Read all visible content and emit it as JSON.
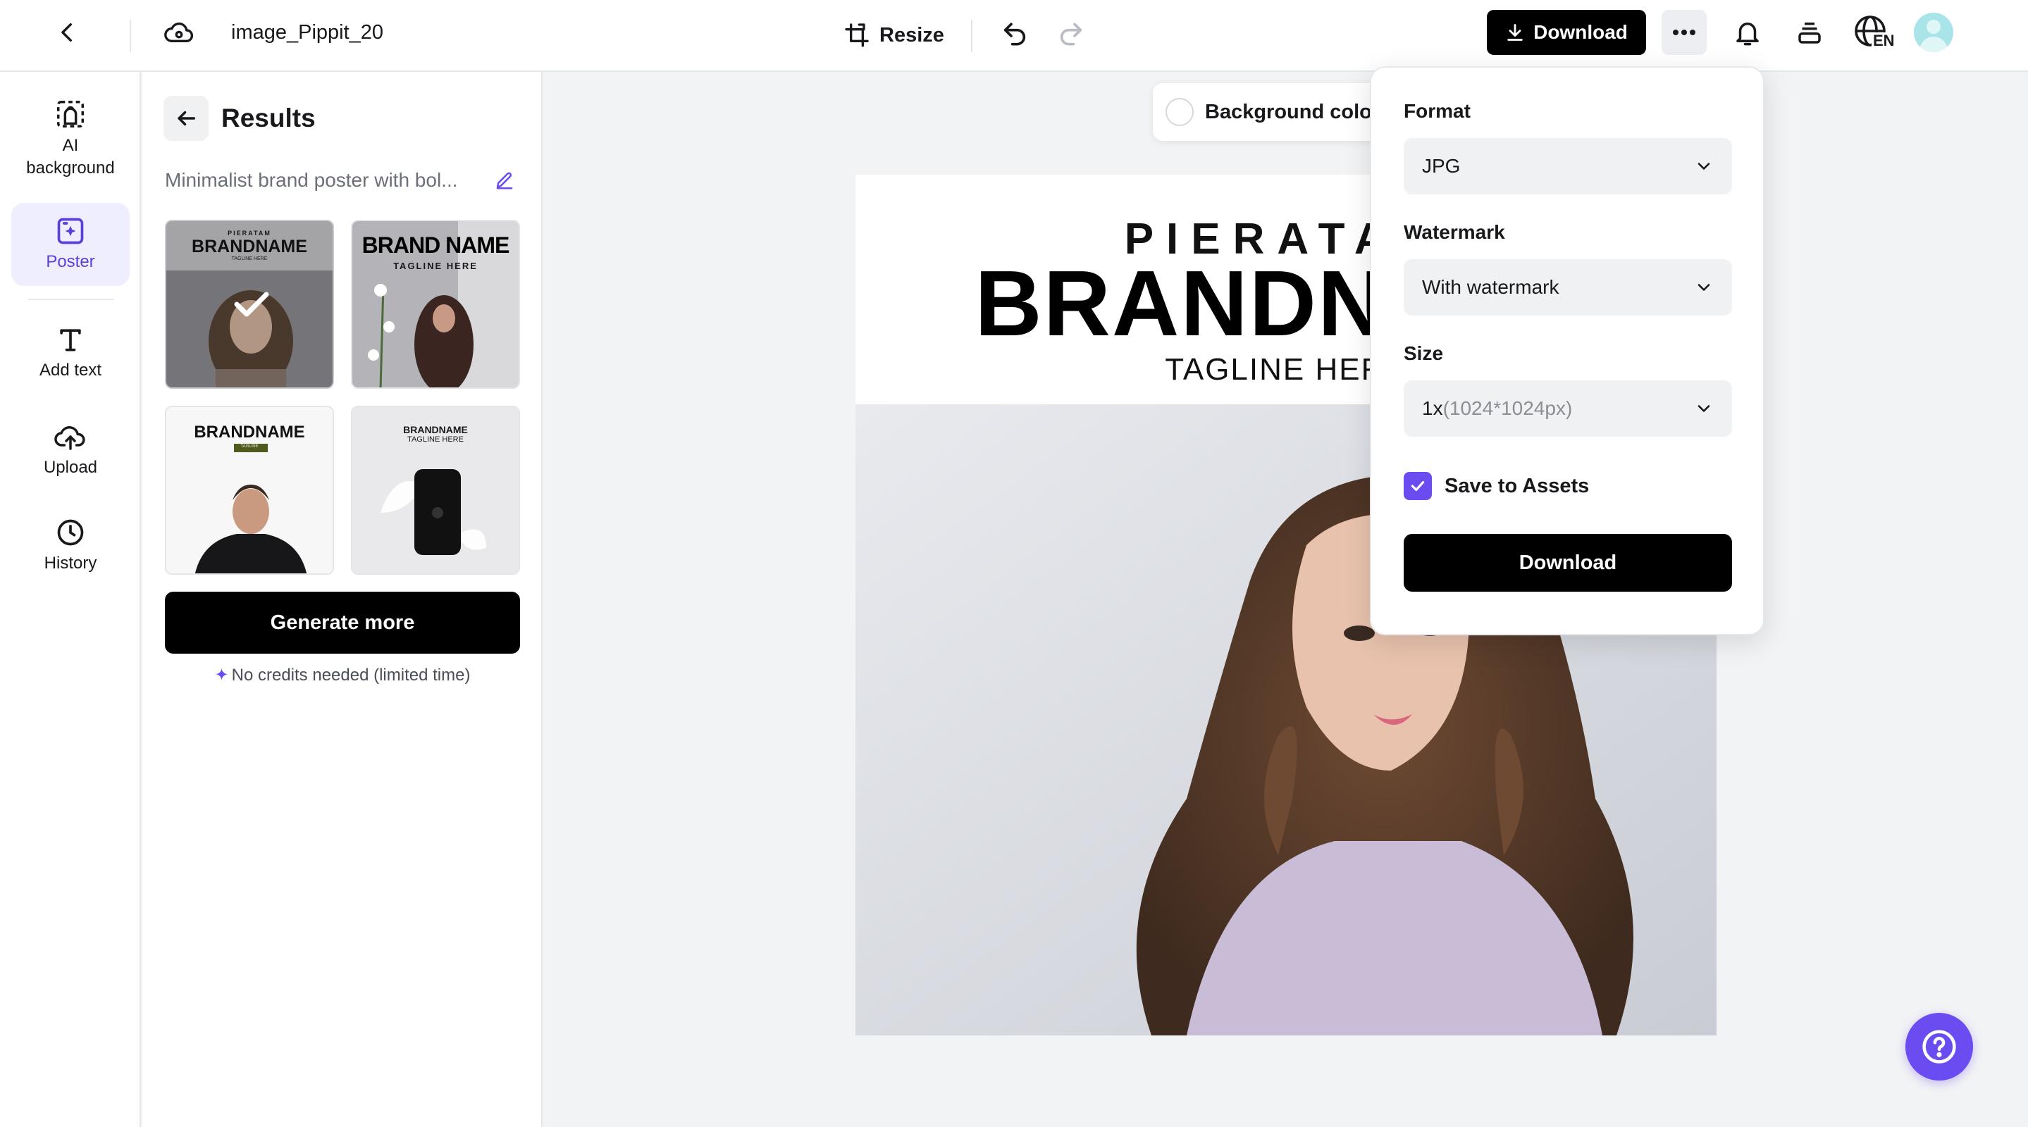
{
  "topbar": {
    "file_name": "image_Pippit_20",
    "resize_label": "Resize",
    "download_label": "Download",
    "language_code": "EN"
  },
  "rail": {
    "items": [
      {
        "label": "AI\nbackground",
        "icon": "ai-background-icon"
      },
      {
        "label": "Poster",
        "icon": "poster-icon",
        "active": true
      },
      {
        "label": "Add text",
        "icon": "text-icon"
      },
      {
        "label": "Upload",
        "icon": "upload-icon"
      },
      {
        "label": "History",
        "icon": "history-icon"
      }
    ]
  },
  "panel": {
    "title": "Results",
    "prompt": "Minimalist brand poster with bol...",
    "thumbnails": [
      {
        "brand": "BRANDNAME",
        "pre": "PIERATAM",
        "tag": "TAGLINE HERE",
        "selected": true
      },
      {
        "brand": "BRAND NAME",
        "tag": "TAGLINE HERE"
      },
      {
        "brand": "BRANDNAME",
        "tag": "TAGLINE"
      },
      {
        "brand": "BRANDNAME",
        "tag": "TAGLINE HERE"
      }
    ],
    "generate_label": "Generate more",
    "credits_note": "No credits needed (limited time)"
  },
  "canvas": {
    "background_color_label": "Background color",
    "poster": {
      "pre_title": "PIERATAM",
      "brand": "BRANDNAME",
      "tagline": "TAGLINE HERE"
    }
  },
  "download_popover": {
    "format_label": "Format",
    "format_value": "JPG",
    "watermark_label": "Watermark",
    "watermark_value": "With watermark",
    "size_label": "Size",
    "size_value_main": "1x",
    "size_value_detail": "(1024*1024px)",
    "save_assets_label": "Save to Assets",
    "save_assets_checked": true,
    "download_label": "Download"
  },
  "colors": {
    "accent": "#6a4cf0",
    "primary_button": "#000000",
    "active_bg": "#efeefe"
  }
}
